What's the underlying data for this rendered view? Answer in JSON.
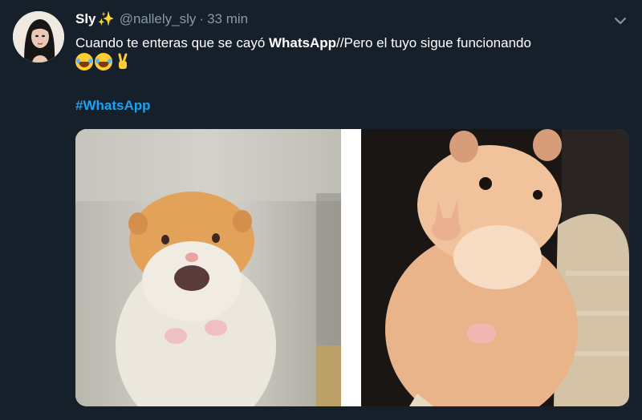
{
  "tweet": {
    "display_name": "Sly",
    "name_emoji": "✨",
    "handle": "@nallely_sly",
    "separator": "·",
    "time": "33 min",
    "text_before": "Cuando te enteras que se cayó ",
    "text_bold": "WhatsApp",
    "text_after": "//Pero el tuyo sigue funcionando",
    "emoji_row": [
      "face-with-tears-of-joy",
      "face-with-tears-of-joy",
      "victory-hand"
    ],
    "hashtag": "#WhatsApp"
  },
  "media": {
    "left_image": "scared-hamster",
    "right_image": "hamster-peace-sign"
  },
  "colors": {
    "background": "#15202b",
    "text": "#ffffff",
    "secondary": "#8899a6",
    "link": "#1da1f2"
  }
}
